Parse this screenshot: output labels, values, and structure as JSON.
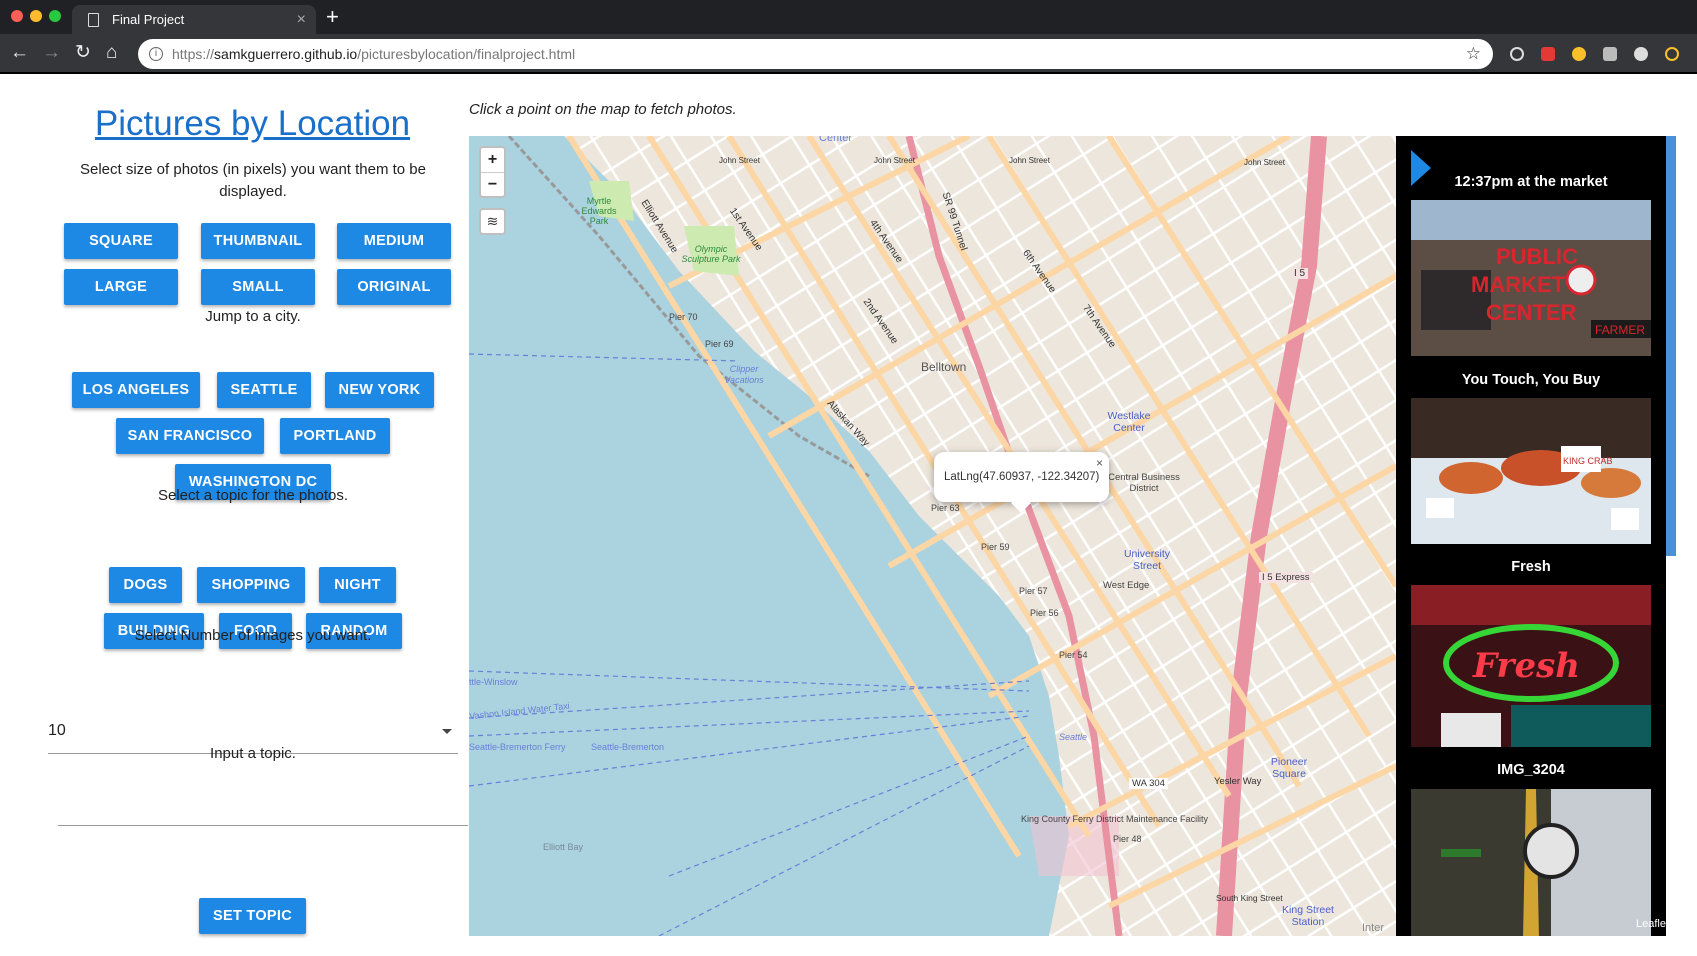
{
  "browser": {
    "tab_title": "Final Project",
    "url_scheme": "https://",
    "url_host": "samkguerrero.github.io",
    "url_path": "/picturesbylocation/finalproject.html"
  },
  "sidebar": {
    "title": "Pictures by Location",
    "size_prompt": "Select size of photos (in pixels) you want them to be displayed.",
    "size_buttons": [
      "SQUARE",
      "THUMBNAIL",
      "MEDIUM",
      "LARGE",
      "SMALL",
      "ORIGINAL"
    ],
    "city_prompt": "Jump to a city.",
    "city_buttons": [
      "LOS ANGELES",
      "SEATTLE",
      "NEW YORK",
      "SAN FRANCISCO",
      "PORTLAND",
      "WASHINGTON DC"
    ],
    "topic_prompt": "Select a topic for the photos.",
    "topic_buttons": [
      "DOGS",
      "SHOPPING",
      "NIGHT",
      "BUILDING",
      "FOOD",
      "RANDOM"
    ],
    "count_prompt": "Select Number of images you want.",
    "count_value": "10",
    "input_prompt": "Input a topic.",
    "input_value": "",
    "set_topic_label": "SET TOPIC"
  },
  "map": {
    "hint": "Click a point on the map to fetch photos.",
    "zoom_in": "+",
    "zoom_out": "−",
    "popup_text": "LatLng(47.60937, -122.34207)",
    "popup_close": "×",
    "attribution": "Leaflet",
    "labels": {
      "belltown": "Belltown",
      "westlake": "Westlake Center",
      "cbd": "Central Business District",
      "university": "University Street",
      "pioneer": "Pioneer Square",
      "west_edge": "West Edge",
      "elliott_bay": "Elliott Bay",
      "pier70": "Pier 70",
      "pier69": "Pier 69",
      "pier63": "Pier 63",
      "pier59": "Pier 59",
      "pier57": "Pier 57",
      "pier56": "Pier 56",
      "pier54": "Pier 54",
      "pier48": "Pier 48",
      "clipper": "Clipper Vacations",
      "olympic": "Olympic Sculpture Park",
      "myrtle": "Myrtle Edwards Park",
      "i5": "I 5",
      "i5exp": "I 5 Express",
      "wa304": "WA 304",
      "kingst": "King Street Station",
      "ferry": "King County Ferry District Maintenance Facility",
      "vashon": "Vashon Island Water Taxi",
      "bremerton": "Seattle-Bremerton Ferry",
      "seattle_brem": "Seattle-Bremerton",
      "winslow": "ttle-Winslow",
      "seattle": "Seattle",
      "yesler": "Yesler Way",
      "s_king": "South King Street",
      "john1": "John Street",
      "john2": "John Street",
      "john3": "John Street",
      "john4": "John Street",
      "alaskan": "Alaskan Way",
      "elliott_ave": "Elliott Avenue",
      "first_ave": "1st Avenue",
      "second_ave": "2nd Avenue",
      "fourth_ave": "4th Avenue",
      "sixth_ave": "6th Avenue",
      "seventh_ave": "7th Avenue",
      "sr99": "SR 99 Tunnel",
      "center": "Center",
      "inter": "Inter"
    }
  },
  "photos": [
    {
      "title": "12:37pm at the market"
    },
    {
      "title": "You Touch, You Buy"
    },
    {
      "title": "Fresh"
    },
    {
      "title": "IMG_3204"
    }
  ],
  "photo_text": {
    "public": "PUBLIC",
    "market": "MARKET",
    "center": "CENTER",
    "farmer": "FARMER",
    "fresh": "Fresh",
    "king_crab": "KING CRAB"
  },
  "colors": {
    "accent": "#1e88e5",
    "link": "#1a6fc9",
    "water": "#aad3df",
    "major_road": "#fcd6a4",
    "highway": "#e892a2"
  }
}
